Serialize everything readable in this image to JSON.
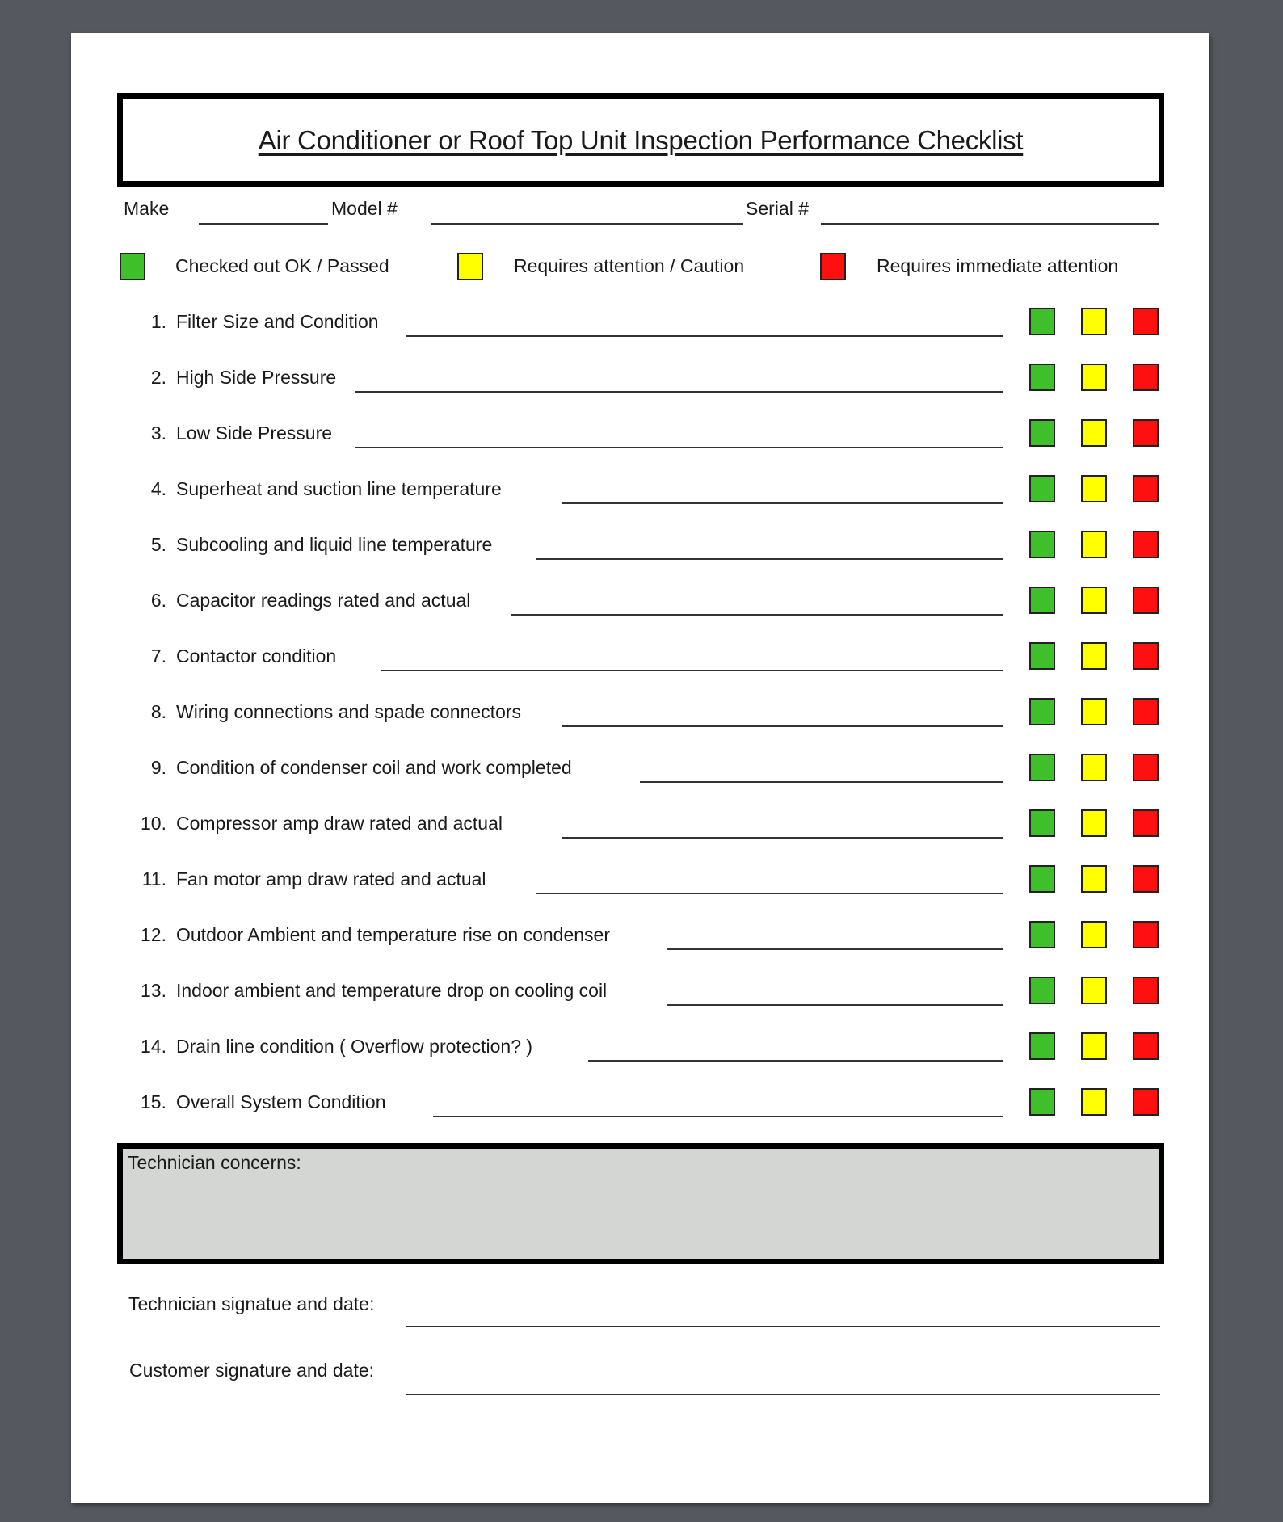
{
  "title": "Air Conditioner or Roof Top Unit Inspection Performance Checklist",
  "header_fields": {
    "make_label": "Make",
    "make_value": "",
    "model_label": "Model #",
    "model_value": "",
    "serial_label": "Serial #",
    "serial_value": ""
  },
  "legend": [
    {
      "color": "#3fbf2a",
      "label": "Checked out OK / Passed"
    },
    {
      "color": "#ffff00",
      "label": "Requires attention / Caution"
    },
    {
      "color": "#ff1010",
      "label": "Requires immediate attention"
    }
  ],
  "status_colors": {
    "pass": "#3fbf2a",
    "caution": "#ffff00",
    "immediate": "#ff1010"
  },
  "items": [
    {
      "number": "1.",
      "label": "Filter Size and Condition",
      "value": ""
    },
    {
      "number": "2.",
      "label": "High Side Pressure",
      "value": ""
    },
    {
      "number": "3.",
      "label": "Low Side Pressure",
      "value": ""
    },
    {
      "number": "4.",
      "label": "Superheat and suction line temperature",
      "value": ""
    },
    {
      "number": "5.",
      "label": "Subcooling and liquid line temperature",
      "value": ""
    },
    {
      "number": "6.",
      "label": "Capacitor readings rated and actual",
      "value": ""
    },
    {
      "number": "7.",
      "label": "Contactor condition",
      "value": ""
    },
    {
      "number": "8.",
      "label": "Wiring connections and spade connectors",
      "value": ""
    },
    {
      "number": "9.",
      "label": "Condition of condenser coil and work completed",
      "value": ""
    },
    {
      "number": "10.",
      "label": "Compressor amp draw rated and actual",
      "value": ""
    },
    {
      "number": "11.",
      "label": "Fan motor amp draw rated and actual",
      "value": ""
    },
    {
      "number": "12.",
      "label": "Outdoor Ambient and temperature rise on condenser",
      "value": ""
    },
    {
      "number": "13.",
      "label": "Indoor ambient and temperature drop on cooling coil",
      "value": ""
    },
    {
      "number": "14.",
      "label": "Drain line condition ( Overflow protection? )",
      "value": ""
    },
    {
      "number": "15.",
      "label": "Overall System Condition",
      "value": ""
    }
  ],
  "concerns": {
    "label": "Technician concerns:",
    "value": ""
  },
  "signatures": {
    "technician_label": "Technician signatue and date:",
    "customer_label": "Customer signature and date:"
  }
}
